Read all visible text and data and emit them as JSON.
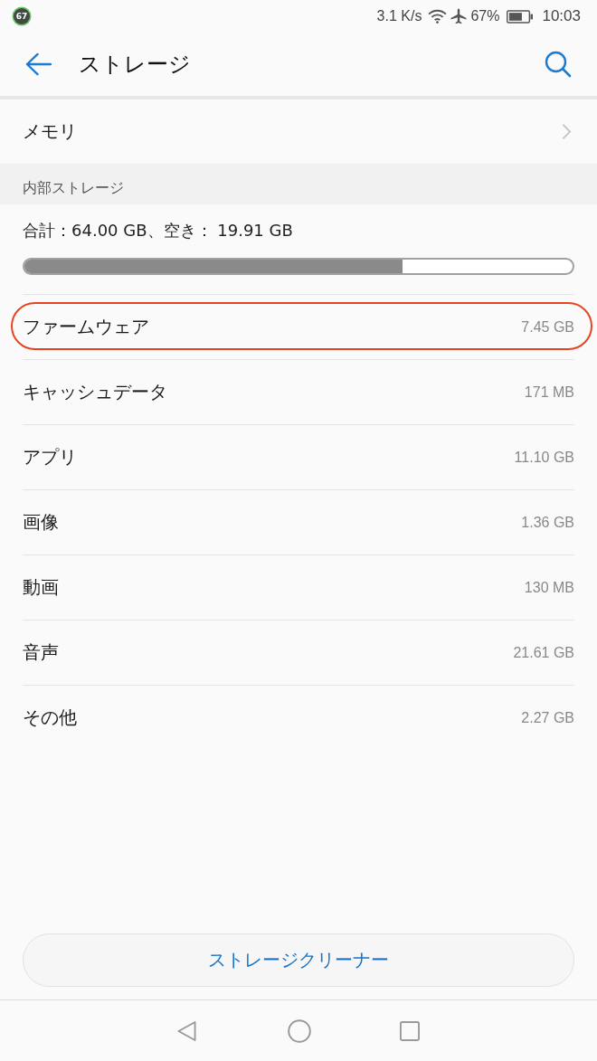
{
  "status_bar": {
    "notification_badge": "67",
    "network_speed": "3.1 K/s",
    "battery_percent": "67%",
    "time": "10:03"
  },
  "app_bar": {
    "title": "ストレージ"
  },
  "memory_row": {
    "label": "メモリ"
  },
  "internal_storage": {
    "header": "内部ストレージ",
    "summary": "合計：64.00 GB、空き： 19.91 GB",
    "usage": {
      "level": 0.69
    }
  },
  "categories": [
    {
      "label": "ファームウェア",
      "value": "7.45 GB",
      "highlighted": true
    },
    {
      "label": "キャッシュデータ",
      "value": "171 MB",
      "highlighted": false
    },
    {
      "label": "アプリ",
      "value": "11.10 GB",
      "highlighted": false
    },
    {
      "label": "画像",
      "value": "1.36 GB",
      "highlighted": false
    },
    {
      "label": "動画",
      "value": "130 MB",
      "highlighted": false
    },
    {
      "label": "音声",
      "value": "21.61 GB",
      "highlighted": false
    },
    {
      "label": "その他",
      "value": "2.27 GB",
      "highlighted": false
    }
  ],
  "cleaner_button": {
    "label": "ストレージクリーナー"
  }
}
